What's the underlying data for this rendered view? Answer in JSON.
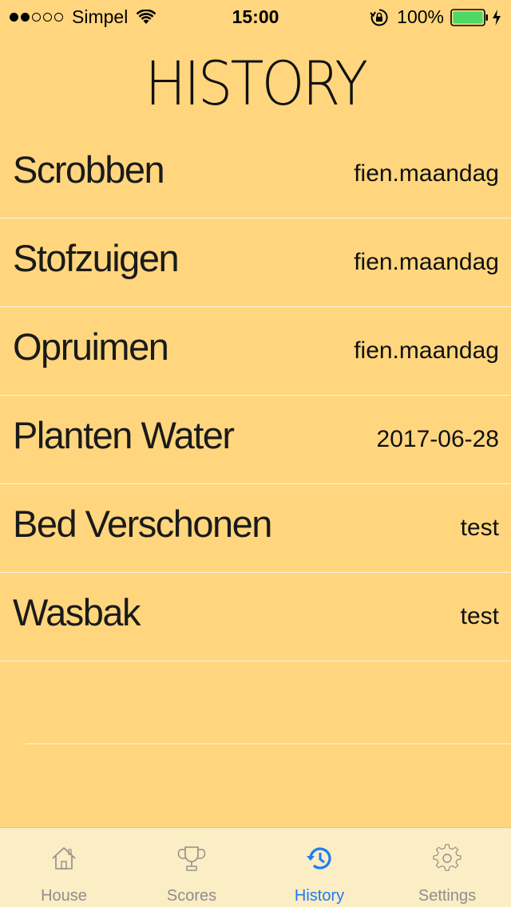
{
  "status_bar": {
    "carrier": "Simpel",
    "time": "15:00",
    "battery_percent": "100%",
    "signal_bars_filled": 2,
    "signal_bars_total": 5
  },
  "title": "HISTORY",
  "history": [
    {
      "task": "Scrobben",
      "user": "fien.maandag"
    },
    {
      "task": "Stofzuigen",
      "user": "fien.maandag"
    },
    {
      "task": "Opruimen",
      "user": "fien.maandag"
    },
    {
      "task": "Planten Water",
      "user": "2017-06-28"
    },
    {
      "task": "Bed Verschonen",
      "user": "test"
    },
    {
      "task": "Wasbak",
      "user": "test"
    }
  ],
  "tabs": [
    {
      "label": "House",
      "icon": "house-icon",
      "active": false
    },
    {
      "label": "Scores",
      "icon": "trophy-icon",
      "active": false
    },
    {
      "label": "History",
      "icon": "history-icon",
      "active": true
    },
    {
      "label": "Settings",
      "icon": "gear-icon",
      "active": false
    }
  ],
  "colors": {
    "background": "#FFD67E",
    "tab_bar": "#FBEDC4",
    "active_tab": "#1E7BF0",
    "inactive_tab": "#8E8E8E",
    "battery": "#4CD964"
  }
}
